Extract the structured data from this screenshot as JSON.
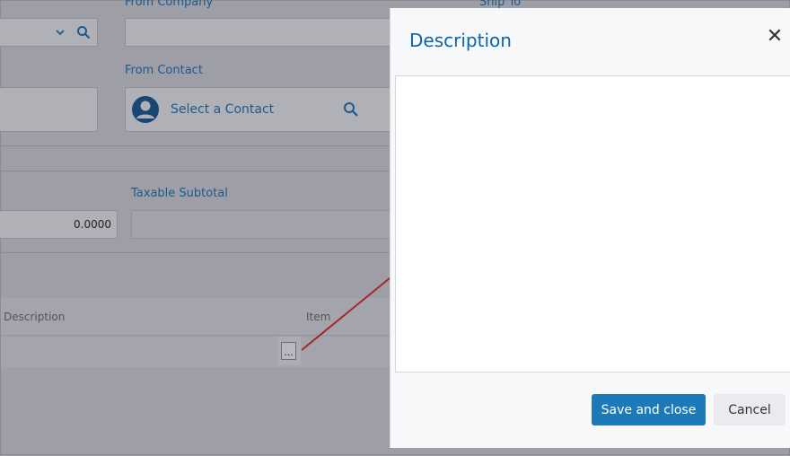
{
  "background_form": {
    "from_company_label": "From Company",
    "ship_to_label": "Ship To",
    "from_contact_label": "From Contact",
    "contact_placeholder": "Select a Contact",
    "taxable_subtotal_label": "Taxable Subtotal",
    "amount_value": "0.0000",
    "grid_headers": [
      "Description",
      "Item"
    ],
    "ellipsis_button": "..."
  },
  "dialog": {
    "title": "Description",
    "editor_value": "",
    "save_label": "Save and close",
    "cancel_label": "Cancel"
  },
  "colors": {
    "accent": "#1b7ab7",
    "title": "#0a66a8",
    "arrow": "#a3262e"
  }
}
